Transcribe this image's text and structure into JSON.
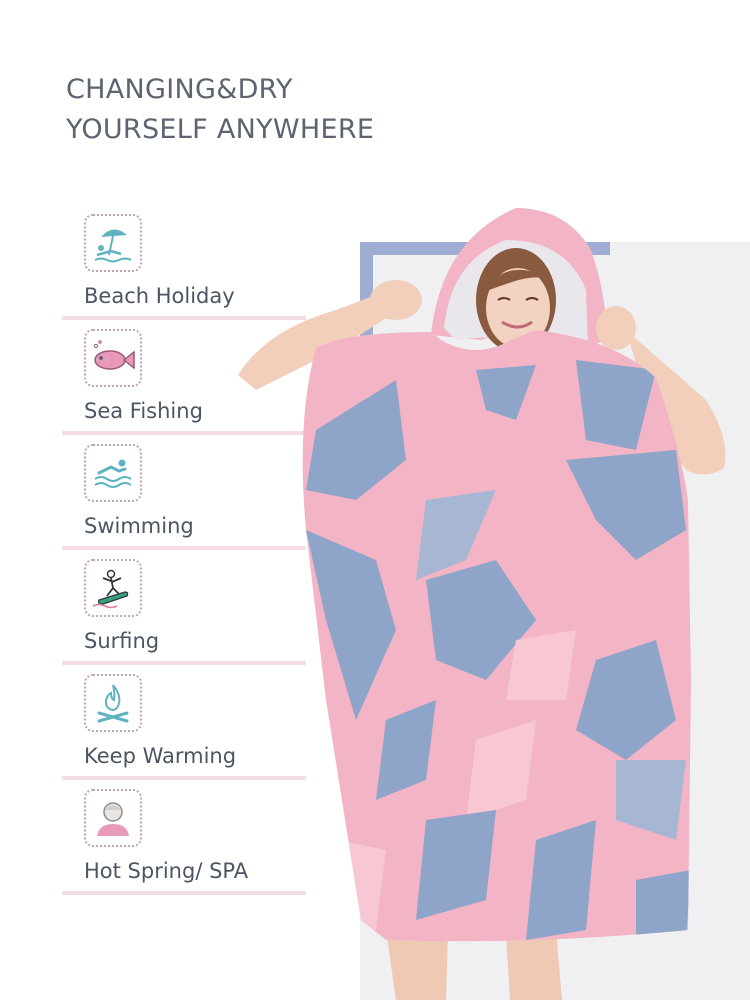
{
  "headline": {
    "line1": "CHANGING&DRY",
    "line2": "YOURSELF ANYWHERE"
  },
  "features": [
    {
      "label": "Beach Holiday",
      "icon": "beach-umbrella-icon"
    },
    {
      "label": "Sea Fishing",
      "icon": "fish-icon"
    },
    {
      "label": "Swimming",
      "icon": "swimmer-icon"
    },
    {
      "label": "Surfing",
      "icon": "surfer-icon"
    },
    {
      "label": "Keep Warming",
      "icon": "campfire-icon"
    },
    {
      "label": "Hot Spring/ SPA",
      "icon": "spa-person-icon"
    }
  ],
  "colors": {
    "icon_teal": "#5fb3c0",
    "icon_pink": "#e89abb",
    "rule_pink": "#f6dce4",
    "towel_pink": "#f3b4c6",
    "towel_blue": "#8ea4c8",
    "frame_blue": "#9fadd3"
  }
}
